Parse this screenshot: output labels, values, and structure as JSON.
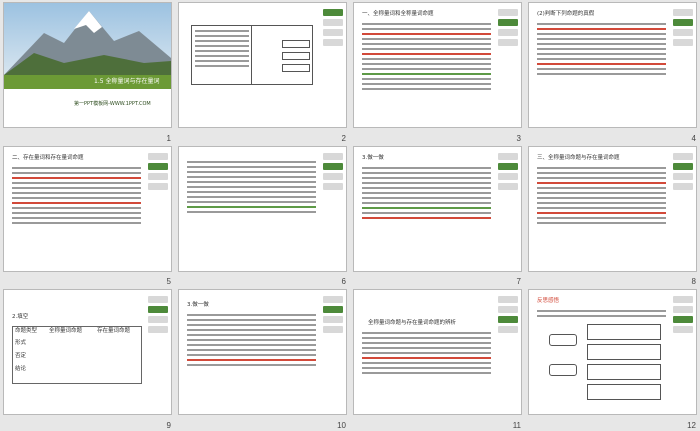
{
  "cover": {
    "title": "1.5 全称量词与存在量词",
    "subtitle": "第一PPT模板网-WWW.1PPT.COM"
  },
  "slide_numbers": [
    "1",
    "2",
    "3",
    "4",
    "5",
    "6",
    "7",
    "8",
    "9",
    "10",
    "11",
    "12"
  ],
  "snippets": {
    "s3_heading": "一、全称量词和全称量词命题",
    "s4_heading": "(2)判断下列命题的真假",
    "s5_heading": "二、存在量词和存在量词命题",
    "s7_heading": "3.做一做",
    "s8_heading": "三、全称量词命题与存在量词命题",
    "s9_heading": "2.填空",
    "s9_col1": "命题类型",
    "s9_col2": "全称量词命题",
    "s9_col3": "存在量词命题",
    "s9_row1": "形式",
    "s9_row2": "否定",
    "s9_row3": "结论",
    "s10_heading": "3.做一做",
    "s11_heading": "全称量词命题与存在量词命题的辨析",
    "s12_heading": "反思感悟"
  },
  "accent": "#4d8a3a",
  "highlight_red": "#d24a3a"
}
